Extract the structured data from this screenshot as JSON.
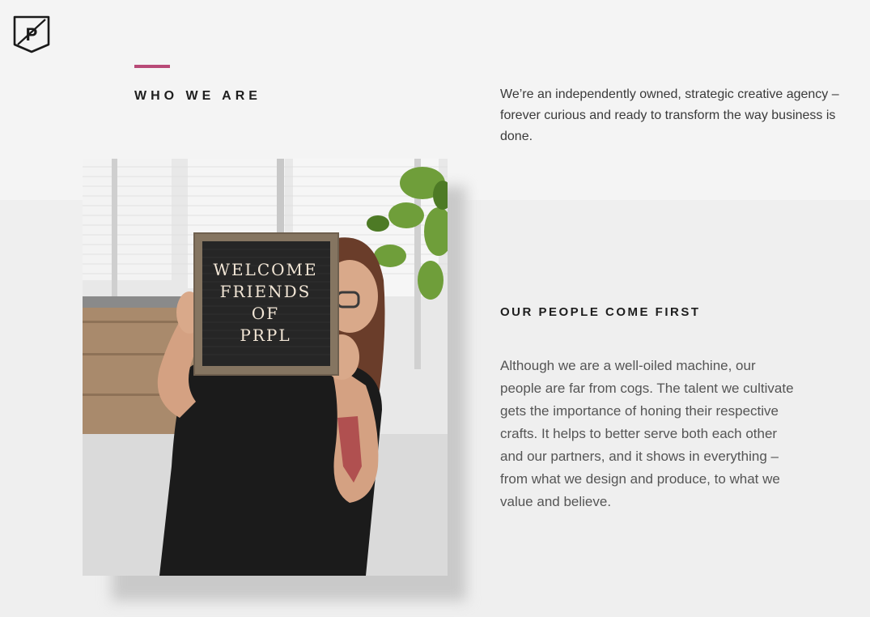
{
  "brand": {
    "logo_icon": "prpl-shield-logo-icon",
    "logo_letter": "P",
    "accent_color": "#b84a77"
  },
  "who_we_are": {
    "heading": "WHO WE ARE",
    "intro": "We’re an independently owned, strategic creative agency – forever curious and ready to transform the way business is done."
  },
  "photo": {
    "sign_lines": [
      "WELCOME",
      "FRIENDS",
      "OF",
      "PRPL"
    ]
  },
  "people": {
    "heading": "OUR PEOPLE COME FIRST",
    "body": "Although we are a well-oiled machine, our people are far from cogs. The talent we cultivate gets the importance of honing their respective crafts. It helps to better serve both each other and our partners, and it shows in everything – from what we design and produce, to what we value and believe."
  }
}
